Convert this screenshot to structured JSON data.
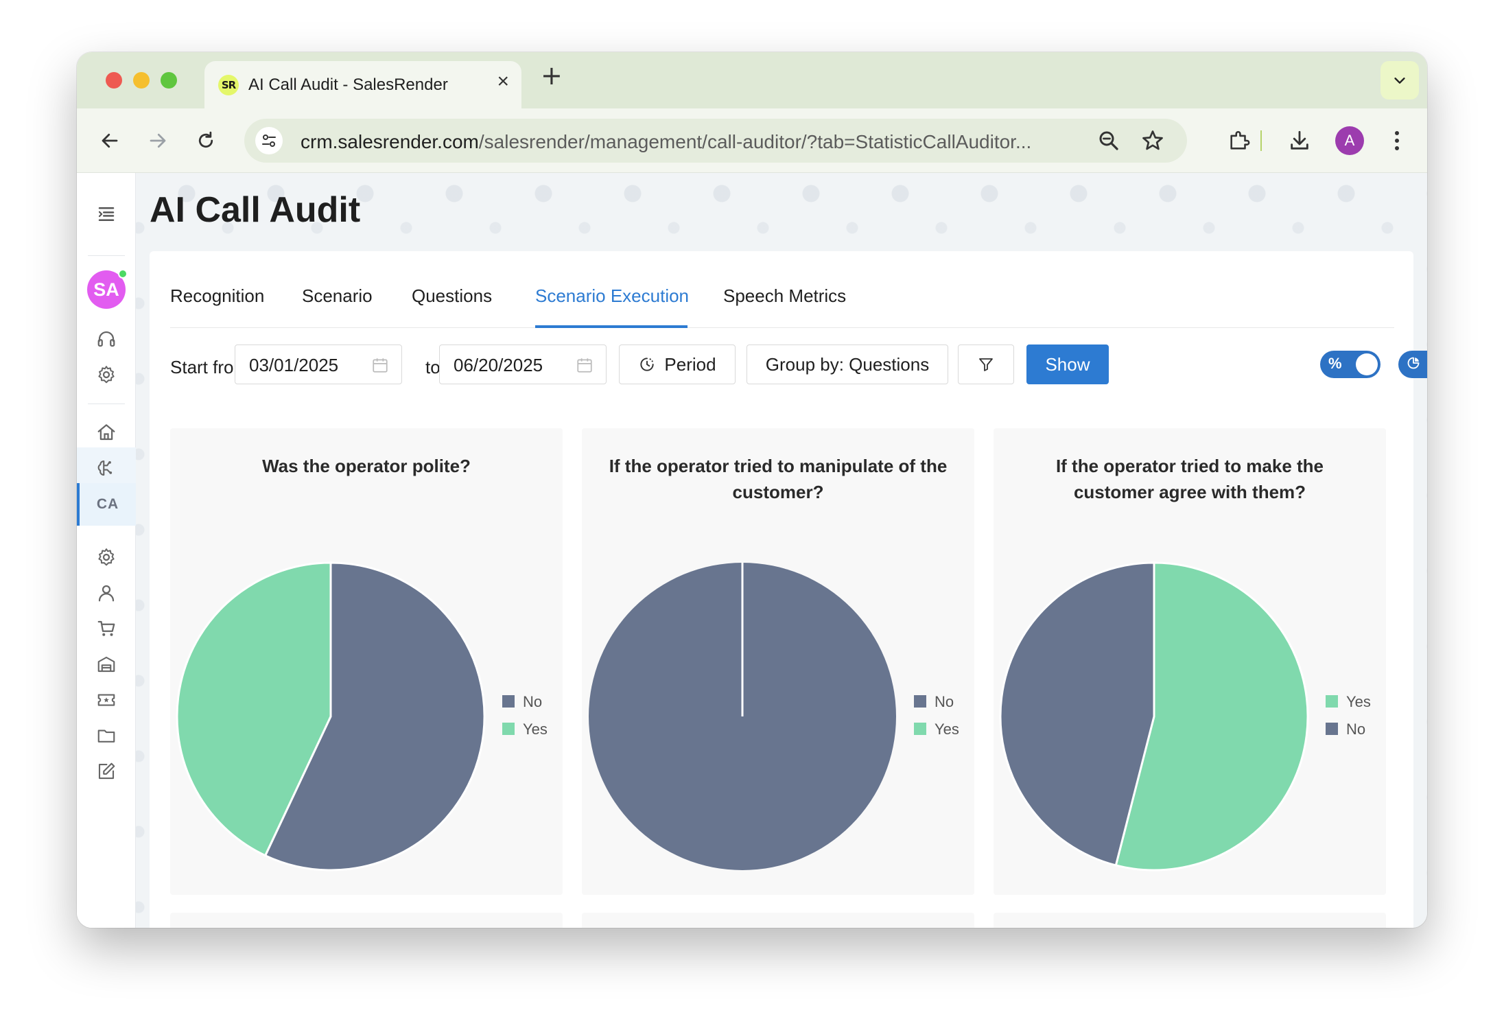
{
  "browser": {
    "tab_title": "AI Call Audit - SalesRender",
    "favicon_text": "SR",
    "url_host": "crm.salesrender.com",
    "url_path": "/salesrender/management/call-auditor/?tab=StatisticCallAuditor...",
    "profile_initial": "A"
  },
  "sidebar": {
    "avatar_initials": "SA",
    "ca_label": "CA"
  },
  "page": {
    "title": "AI Call Audit"
  },
  "tabs": [
    {
      "label": "Recognition"
    },
    {
      "label": "Scenario"
    },
    {
      "label": "Questions"
    },
    {
      "label": "Scenario Execution"
    },
    {
      "label": "Speech Metrics"
    }
  ],
  "filters": {
    "start_label": "Start from",
    "start_date": "03/01/2025",
    "to_label": "to",
    "end_date": "06/20/2025",
    "period_label": "Period",
    "group_label": "Group by: Questions",
    "show_label": "Show",
    "percent_toggle_glyph": "%"
  },
  "colors": {
    "no": "#68758f",
    "yes": "#80d9ad",
    "accent": "#2d7bd2"
  },
  "chart_data": [
    {
      "type": "pie",
      "title": "Was the operator polite?",
      "legend_order": [
        "No",
        "Yes"
      ],
      "slices": [
        {
          "label": "No",
          "value": 57,
          "color": "#68758f"
        },
        {
          "label": "Yes",
          "value": 43,
          "color": "#80d9ad"
        }
      ]
    },
    {
      "type": "pie",
      "title": "If the operator tried to manipulate of the customer?",
      "legend_order": [
        "No",
        "Yes"
      ],
      "slices": [
        {
          "label": "No",
          "value": 100,
          "color": "#68758f"
        },
        {
          "label": "Yes",
          "value": 0,
          "color": "#80d9ad"
        }
      ]
    },
    {
      "type": "pie",
      "title": "If the operator tried to make the customer agree with them?",
      "legend_order": [
        "Yes",
        "No"
      ],
      "slices": [
        {
          "label": "Yes",
          "value": 54,
          "color": "#80d9ad"
        },
        {
          "label": "No",
          "value": 46,
          "color": "#68758f"
        }
      ]
    }
  ]
}
